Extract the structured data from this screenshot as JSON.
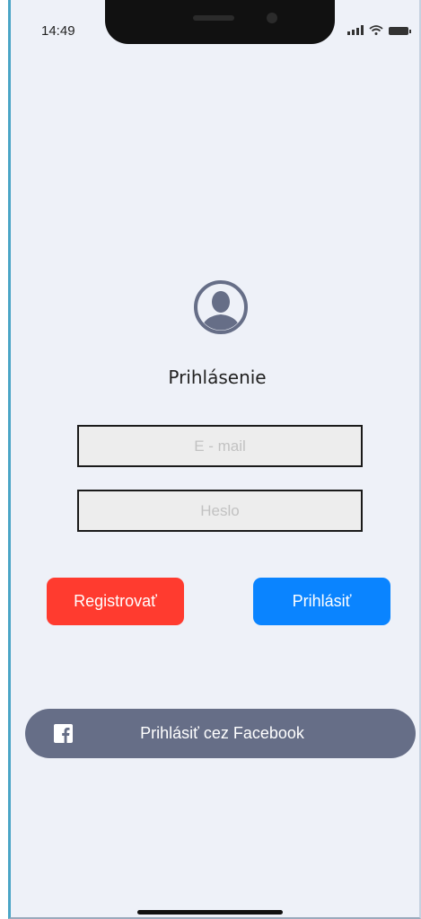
{
  "status_bar": {
    "time": "14:49"
  },
  "login": {
    "title": "Prihlásenie",
    "email_placeholder": "E - mail",
    "password_placeholder": "Heslo",
    "register_label": "Registrovať",
    "login_label": "Prihlásiť",
    "facebook_label": "Prihlásiť cez Facebook"
  },
  "colors": {
    "background": "#eef1f8",
    "register_button": "#ff3b2f",
    "login_button": "#0a84ff",
    "facebook_button": "#666e87",
    "user_icon": "#666e87"
  },
  "icons": {
    "user": "user-avatar-icon",
    "facebook": "facebook-icon",
    "signal": "signal-icon",
    "wifi": "wifi-icon",
    "battery": "battery-icon"
  }
}
